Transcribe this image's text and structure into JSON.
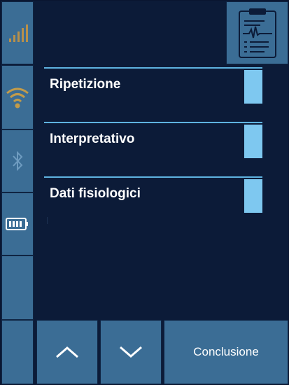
{
  "status_column": {
    "icons": [
      "signal-bars-icon",
      "wifi-icon",
      "bluetooth-icon",
      "battery-icon",
      "empty-slot"
    ]
  },
  "menu": {
    "items": [
      {
        "label": "Ripetizione",
        "checked": false
      },
      {
        "label": "Interpretativo",
        "checked": false
      },
      {
        "label": "Dati fisiologici",
        "checked": false
      }
    ]
  },
  "bottom_bar": {
    "conclusion_label": "Conclusione"
  },
  "colors": {
    "background": "#0c1b38",
    "panel": "#3b6d95",
    "accent_line": "#5fb3e0",
    "checkbox": "#7ec8f0",
    "icon_inactive": "#c29b4a"
  }
}
